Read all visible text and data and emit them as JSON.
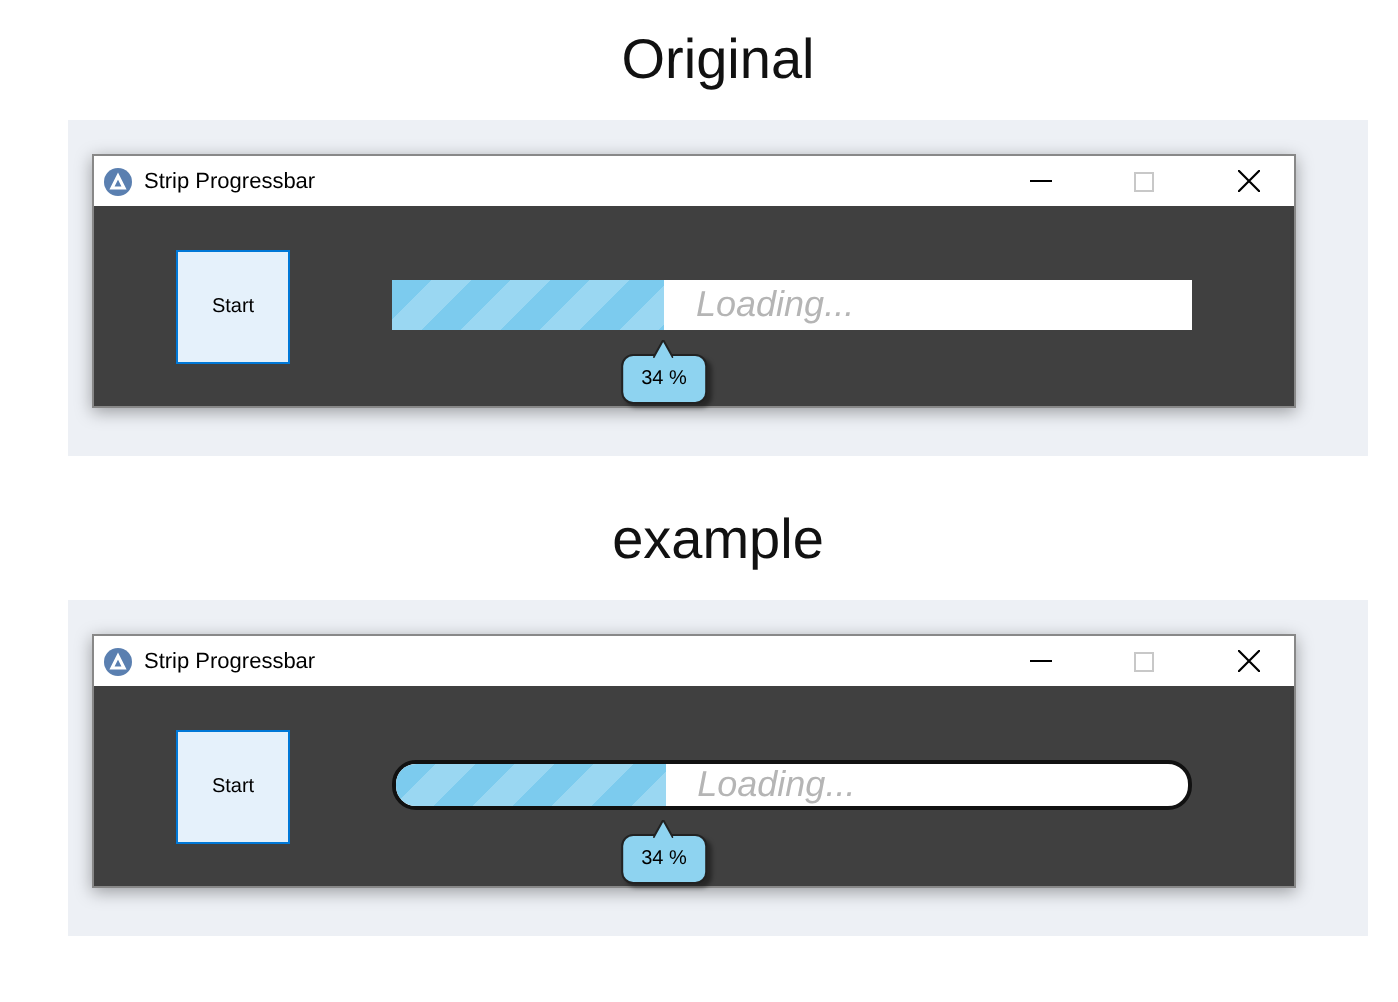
{
  "sections": [
    {
      "heading": "Original",
      "window": {
        "title": "Strip Progressbar"
      },
      "button": "Start",
      "progress": {
        "kind": "square",
        "placeholder": "Loading...",
        "level": 0.34,
        "tooltip": "34 %"
      }
    },
    {
      "heading": "example",
      "window": {
        "title": "Strip Progressbar"
      },
      "button": "Start",
      "progress": {
        "kind": "rounded",
        "placeholder": "Loading...",
        "level": 0.34,
        "tooltip": "34 %"
      }
    }
  ]
}
